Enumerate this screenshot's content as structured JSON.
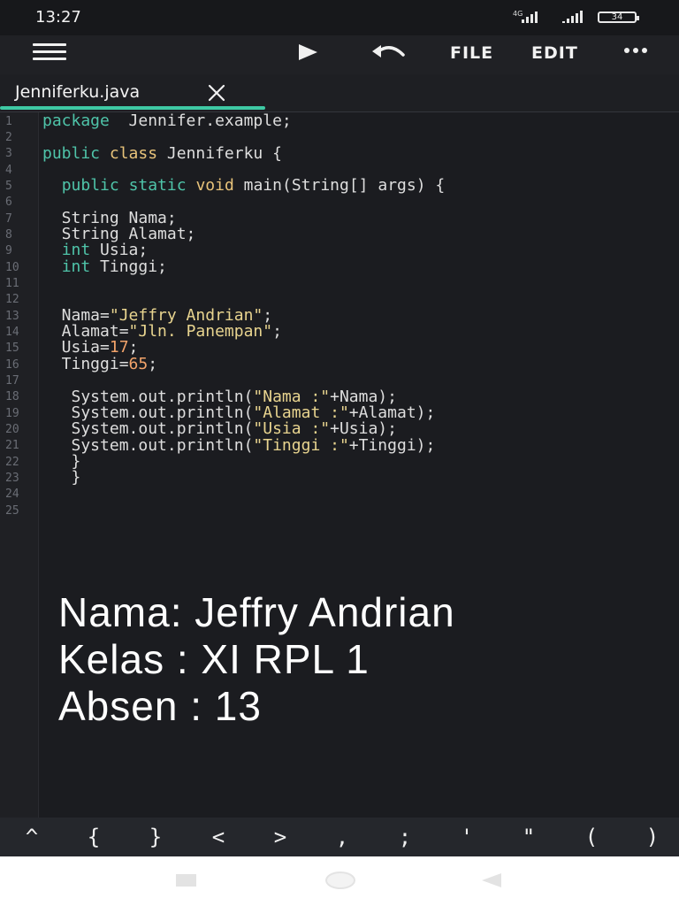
{
  "status_bar": {
    "time": "13:27",
    "network_label": "4G",
    "battery": "34"
  },
  "toolbar": {
    "file_label": "FILE",
    "edit_label": "EDIT",
    "icons": [
      "menu-icon",
      "play-icon",
      "undo-icon",
      "more-icon"
    ]
  },
  "tab": {
    "label": "Jenniferku.java"
  },
  "editor": {
    "line_numbers": [
      "1",
      "2",
      "3",
      "4",
      "5",
      "6",
      "7",
      "8",
      "9",
      "10",
      "11",
      "12",
      "13",
      "14",
      "15",
      "16",
      "17",
      "18",
      "19",
      "20",
      "21",
      "22",
      "23",
      "24",
      "25"
    ]
  },
  "overlay": {
    "line1": "Nama: Jeffry Andrian",
    "line2": "Kelas : XI RPL 1",
    "line3": "Absen : 13"
  },
  "symbol_bar": {
    "keys": [
      "^",
      "{",
      "}",
      "<",
      ">",
      ",",
      ";",
      "'",
      "\"",
      "(",
      ")"
    ]
  },
  "colors": {
    "accent": "#3ec9a4",
    "keyword": "#4fc4a9",
    "type": "#e8c37a",
    "string": "#e8d48f",
    "number": "#f2a36a"
  }
}
